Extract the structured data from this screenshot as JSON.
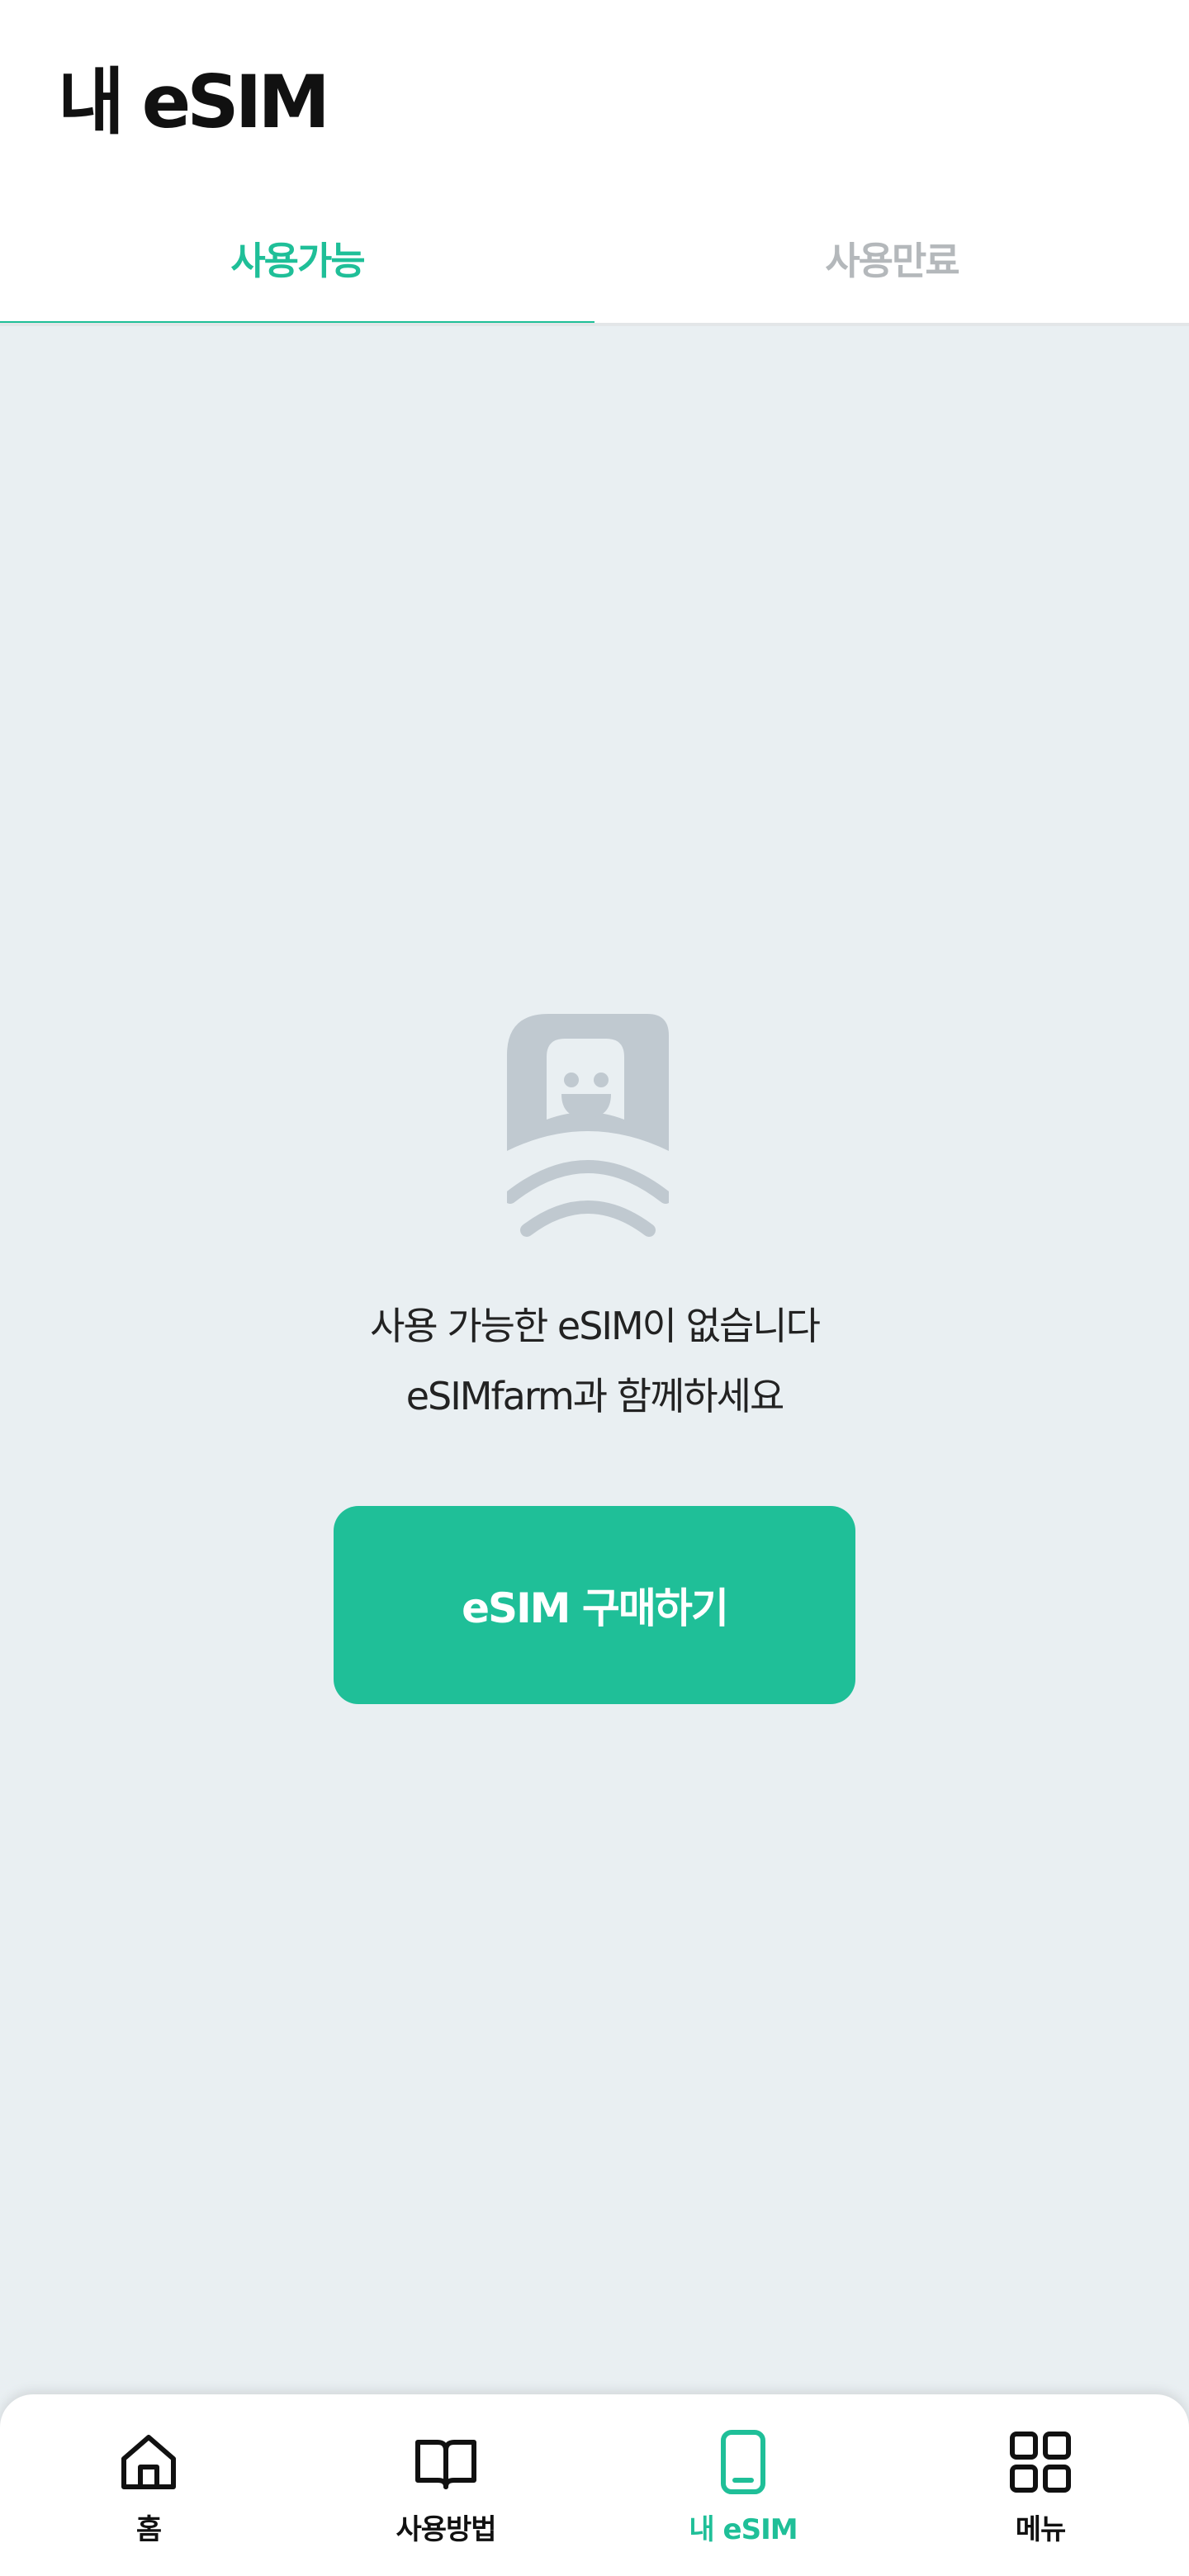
{
  "header": {
    "title": "내 eSIM"
  },
  "tabs": [
    {
      "label": "사용가능",
      "active": true
    },
    {
      "label": "사용만료",
      "active": false
    }
  ],
  "empty_state": {
    "illustration": "esim-character-icon",
    "line1": "사용 가능한 eSIM이 없습니다",
    "line2": "eSIMfarm과 함께하세요",
    "button_label": "eSIM 구매하기"
  },
  "bottom_nav": [
    {
      "label": "홈",
      "icon": "home-icon",
      "active": false
    },
    {
      "label": "사용방법",
      "icon": "book-icon",
      "active": false
    },
    {
      "label": "내 eSIM",
      "icon": "phone-icon",
      "active": true
    },
    {
      "label": "메뉴",
      "icon": "grid-icon",
      "active": false
    }
  ],
  "colors": {
    "accent": "#1fbf98",
    "background": "#e9eff2",
    "inactive_tab": "#b4b8bb",
    "illustration": "#c0c9d0"
  }
}
